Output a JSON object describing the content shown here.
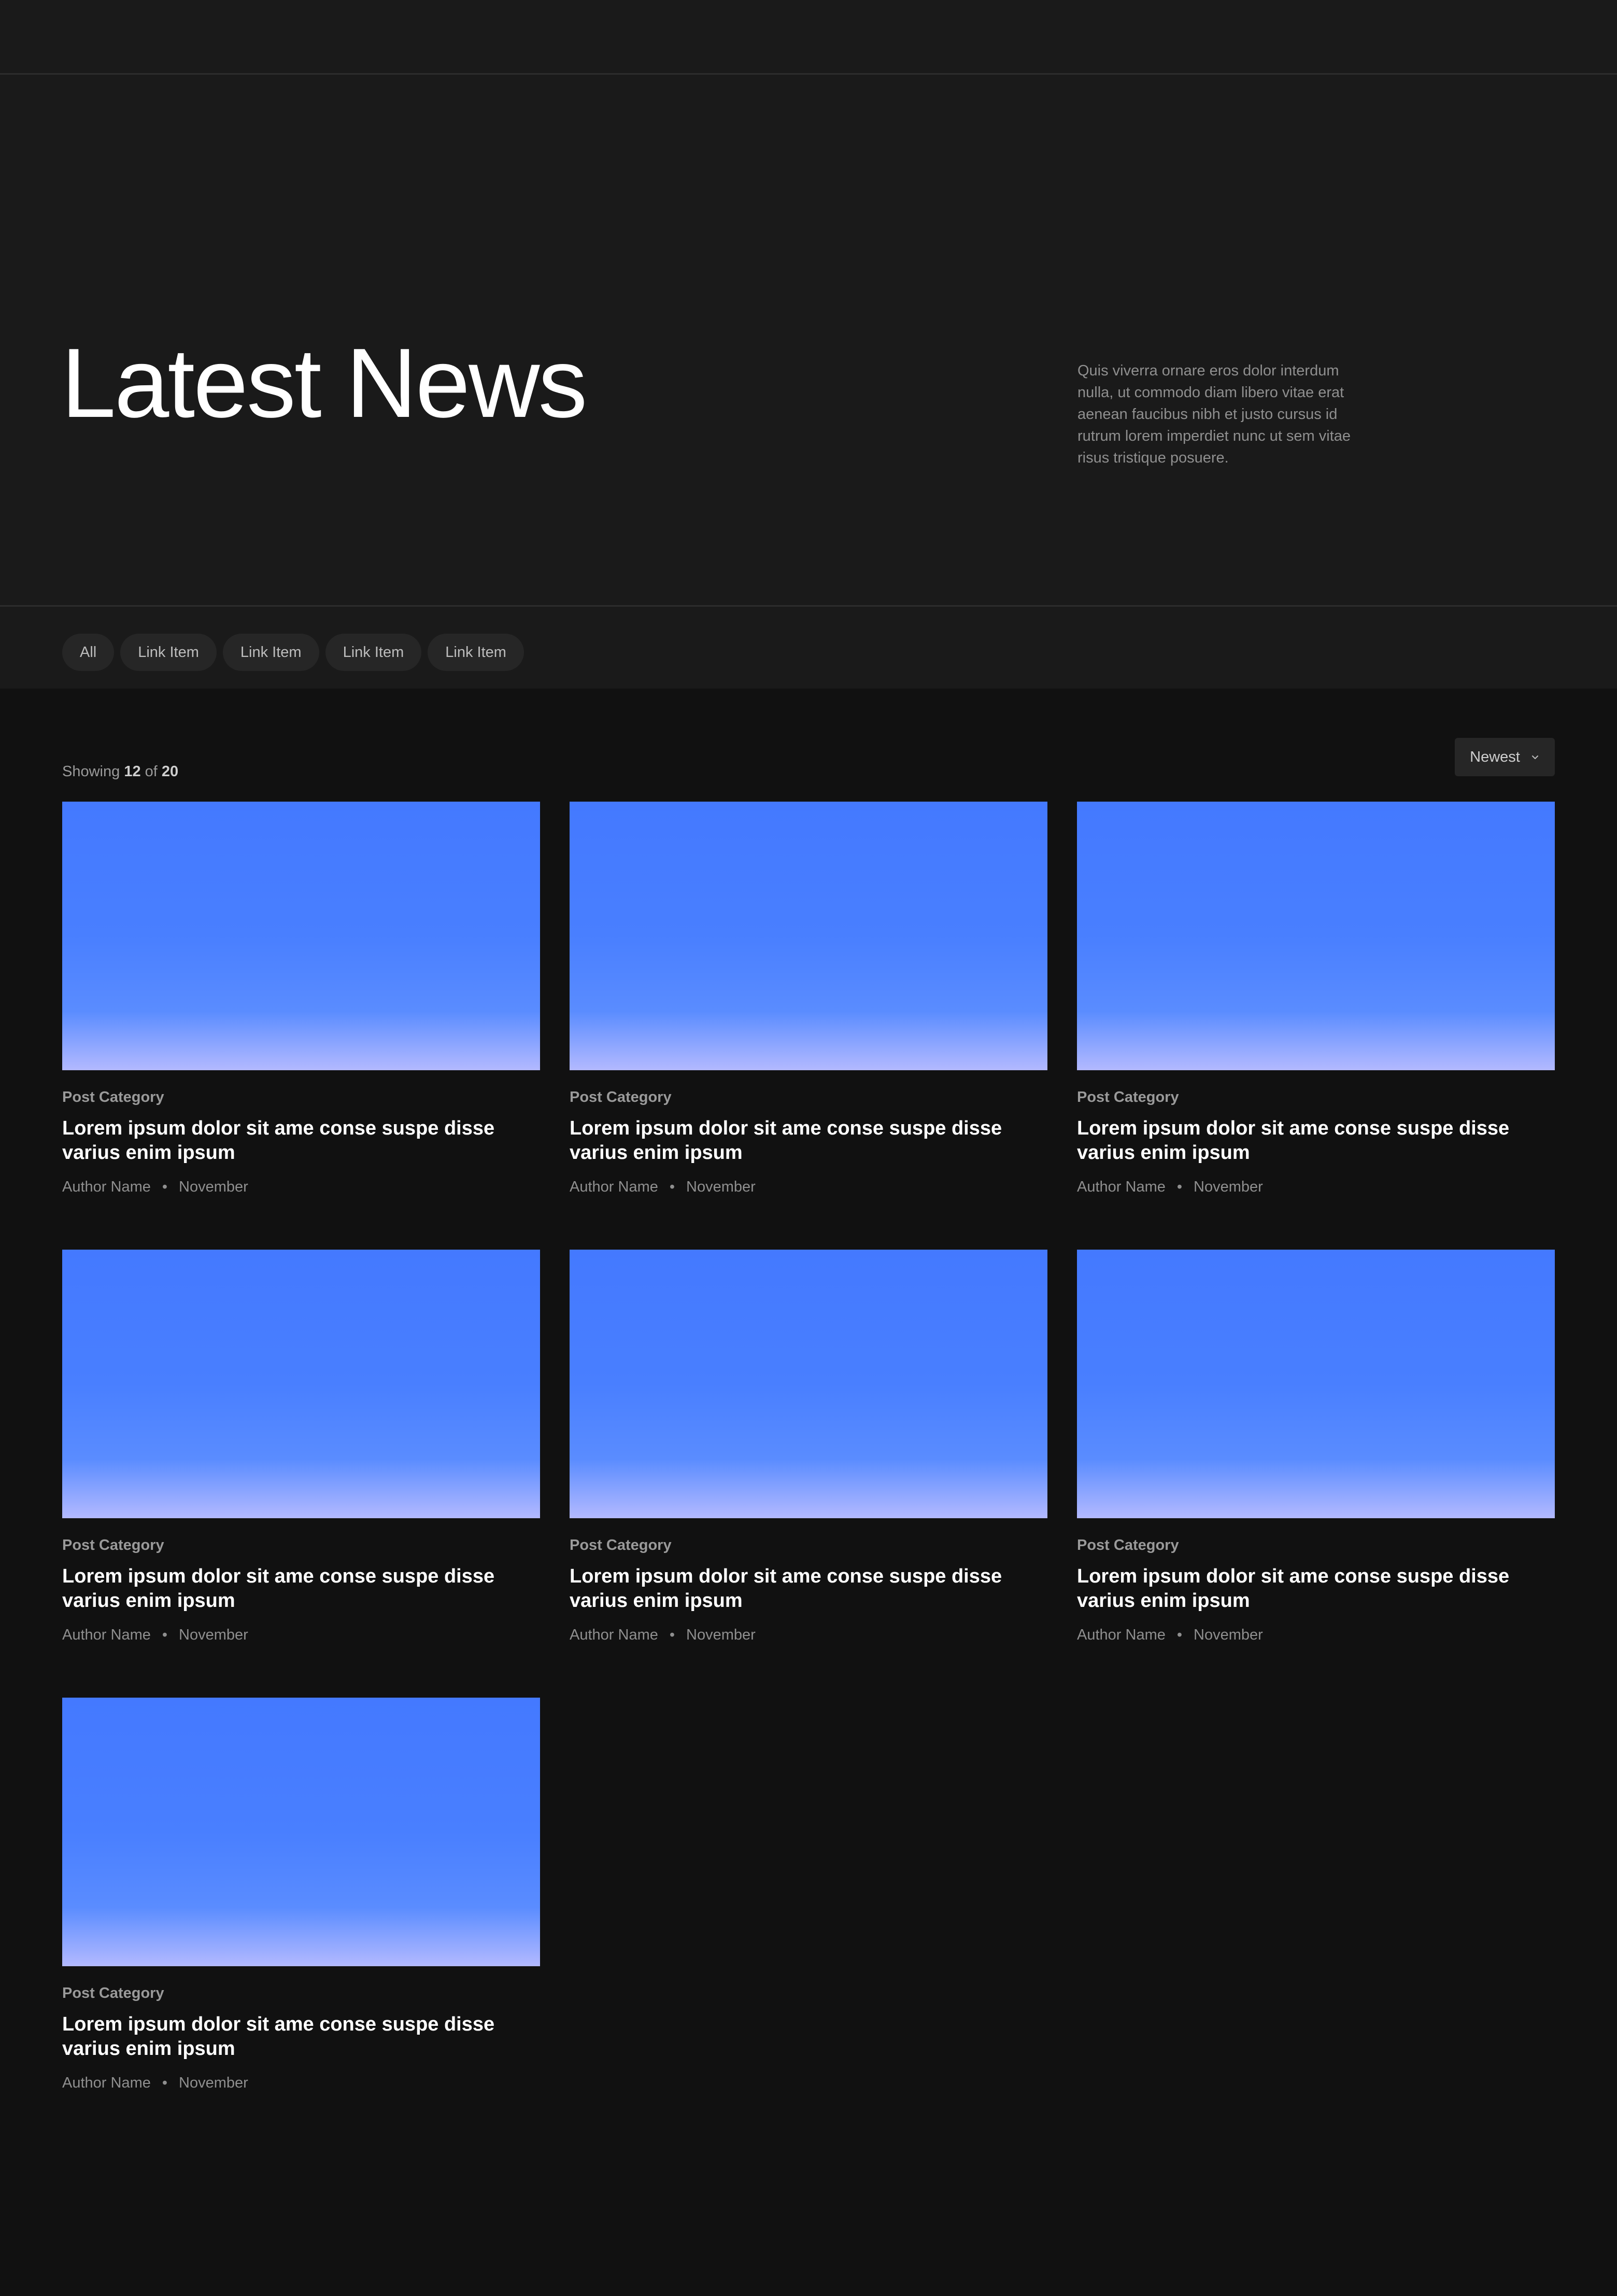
{
  "hero": {
    "title": "Latest News",
    "description": "Quis viverra ornare eros dolor interdum nulla, ut commodo diam libero vitae erat aenean faucibus nibh et justo cursus id rutrum lorem imperdiet nunc ut sem vitae risus tristique posuere."
  },
  "filters": [
    "All",
    "Link Item",
    "Link Item",
    "Link Item",
    "Link Item"
  ],
  "listing": {
    "showing_label": "Showing",
    "shown_count": "12",
    "of_label": "of",
    "total_count": "20",
    "sort_label": "Newest",
    "sort_icon": "chevron-down-icon"
  },
  "thumbnail_colors": {
    "top": "#4479ff",
    "bottom": "#b3b9ff"
  },
  "posts": [
    {
      "category": "Post Category",
      "title": "Lorem ipsum dolor sit ame conse suspe disse varius enim ipsum",
      "author": "Author Name",
      "separator": "•",
      "date": "November"
    },
    {
      "category": "Post Category",
      "title": "Lorem ipsum dolor sit ame conse suspe disse varius enim ipsum",
      "author": "Author Name",
      "separator": "•",
      "date": "November"
    },
    {
      "category": "Post Category",
      "title": "Lorem ipsum dolor sit ame conse suspe disse varius enim ipsum",
      "author": "Author Name",
      "separator": "•",
      "date": "November"
    },
    {
      "category": "Post Category",
      "title": "Lorem ipsum dolor sit ame conse suspe disse varius enim ipsum",
      "author": "Author Name",
      "separator": "•",
      "date": "November"
    },
    {
      "category": "Post Category",
      "title": "Lorem ipsum dolor sit ame conse suspe disse varius enim ipsum",
      "author": "Author Name",
      "separator": "•",
      "date": "November"
    },
    {
      "category": "Post Category",
      "title": "Lorem ipsum dolor sit ame conse suspe disse varius enim ipsum",
      "author": "Author Name",
      "separator": "•",
      "date": "November"
    },
    {
      "category": "Post Category",
      "title": "Lorem ipsum dolor sit ame conse suspe disse varius enim ipsum",
      "author": "Author Name",
      "separator": "•",
      "date": "November"
    }
  ]
}
